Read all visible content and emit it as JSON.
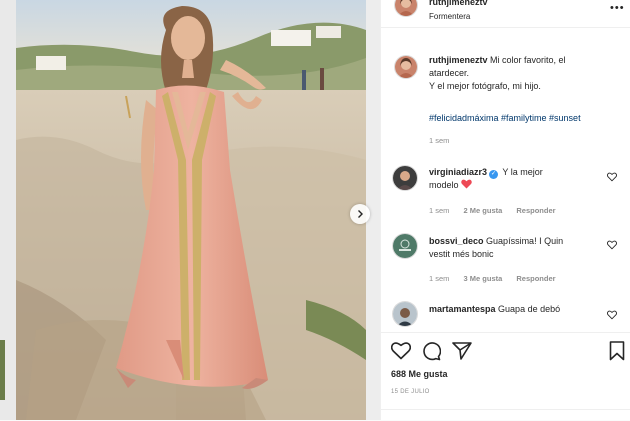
{
  "post": {
    "author": "ruthjimeneztv",
    "location": "Formentera",
    "caption": {
      "author": "ruthjimeneztv",
      "line1": "Mi color favorito, el",
      "line2": "atardecer.",
      "line3": "Y el mejor fotógrafo, mi hijo.",
      "hashtags": "#felicidadmáxima #familytime #sunset",
      "time": "1 sem"
    },
    "comments": [
      {
        "user": "virginiadiazr3",
        "verified": true,
        "text_line1": "Y la mejor",
        "text_line2": "modelo",
        "heart_emoji": "❤️",
        "time": "1 sem",
        "likes": "2 Me gusta",
        "reply": "Responder"
      },
      {
        "user": "bossvi_deco",
        "verified": false,
        "text_line1": "Guapíssima! I Quin",
        "text_line2": "vestit més bonic",
        "time": "1 sem",
        "likes": "3 Me gusta",
        "reply": "Responder"
      },
      {
        "user": "martamantespa",
        "verified": false,
        "text_line1": "Guapa de debó"
      }
    ],
    "likes": "688 Me gusta",
    "date": "15 DE JULIO"
  },
  "icons": {
    "more": "more-options-icon",
    "like": "heart-icon",
    "comment": "comment-icon",
    "share": "share-icon",
    "save": "bookmark-icon",
    "next": "chevron-right-icon"
  },
  "colors": {
    "link": "#00376b",
    "verified": "#3897f0",
    "heart": "#ed4956"
  }
}
